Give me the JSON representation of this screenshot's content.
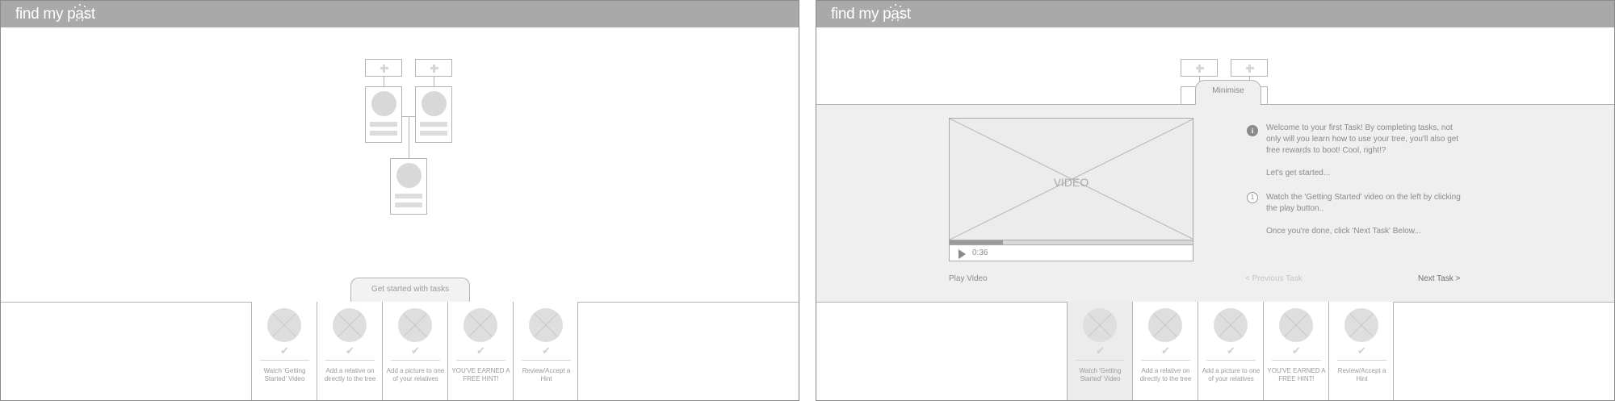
{
  "logo": {
    "text": "find my past"
  },
  "left_screen": {
    "tasks_tab_label": "Get started with tasks"
  },
  "right_screen": {
    "minimise_label": "Minimise",
    "video": {
      "label": "VIDEO",
      "time": "0:36",
      "progress": 0.22
    },
    "play_video_label": "Play Video",
    "info_text": "Welcome to your first Task! By completing tasks, not only will you learn how to use your tree, you'll also get free rewards to boot! Cool, right!?",
    "lets_get_started": "Let's get started...",
    "step_number": "1",
    "step_text": "Watch the 'Getting Started' video on the left by clicking the play button..",
    "once_done": "Once you're done, click 'Next Task' Below...",
    "previous_task_label": "< Previous Task",
    "next_task_label": "Next Task >"
  },
  "tasks": [
    {
      "label": "Watch 'Getting Started' Video"
    },
    {
      "label": "Add a relative on directly to the tree"
    },
    {
      "label": "Add a picture to one of your relatives"
    },
    {
      "label": "YOU'VE EARNED A FREE HINT!"
    },
    {
      "label": "Review/Accept a Hint"
    }
  ]
}
